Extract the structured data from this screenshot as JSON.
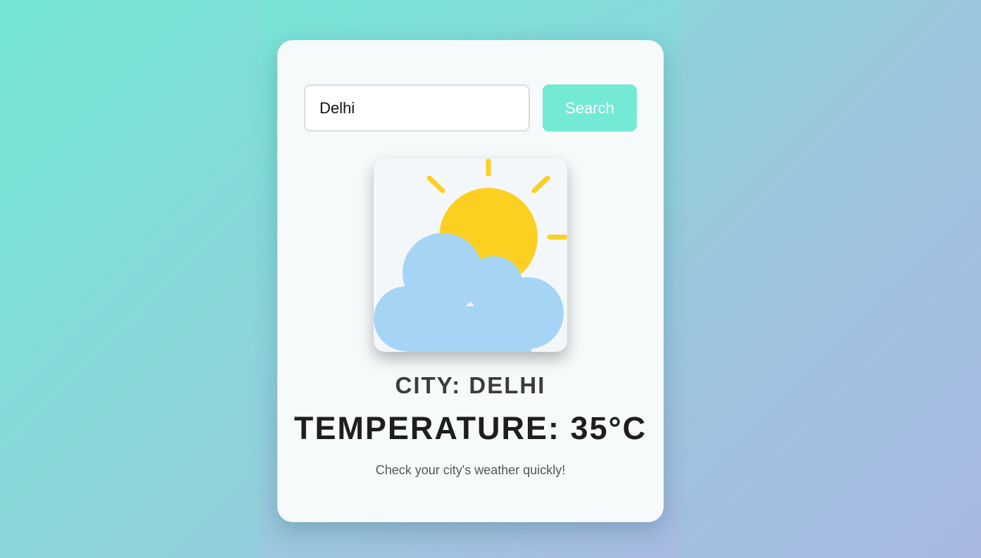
{
  "search": {
    "value": "Delhi",
    "button_label": "Search"
  },
  "weather": {
    "icon": "partly-cloudy-icon",
    "city_line": "CITY: DELHI",
    "temperature_line": "TEMPERATURE: 35°C"
  },
  "tagline": "Check your city's weather quickly!",
  "colors": {
    "accent": "#74ead4",
    "sun": "#fcd020",
    "cloud": "#a6d4f5",
    "card": "#f7fafb"
  }
}
